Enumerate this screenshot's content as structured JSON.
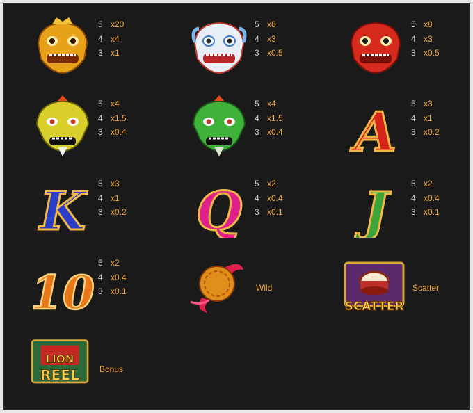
{
  "symbols": [
    {
      "name": "gold-lion",
      "pays": [
        {
          "count": "5",
          "mult": "x20"
        },
        {
          "count": "4",
          "mult": "x4"
        },
        {
          "count": "3",
          "mult": "x1"
        }
      ]
    },
    {
      "name": "white-lion",
      "pays": [
        {
          "count": "5",
          "mult": "x8"
        },
        {
          "count": "4",
          "mult": "x3"
        },
        {
          "count": "3",
          "mult": "x0.5"
        }
      ]
    },
    {
      "name": "red-lion",
      "pays": [
        {
          "count": "5",
          "mult": "x8"
        },
        {
          "count": "4",
          "mult": "x3"
        },
        {
          "count": "3",
          "mult": "x0.5"
        }
      ]
    },
    {
      "name": "yellow-lion",
      "pays": [
        {
          "count": "5",
          "mult": "x4"
        },
        {
          "count": "4",
          "mult": "x1.5"
        },
        {
          "count": "3",
          "mult": "x0.4"
        }
      ]
    },
    {
      "name": "green-lion",
      "pays": [
        {
          "count": "5",
          "mult": "x4"
        },
        {
          "count": "4",
          "mult": "x1.5"
        },
        {
          "count": "3",
          "mult": "x0.4"
        }
      ]
    },
    {
      "name": "letter-a",
      "letter": "A",
      "pays": [
        {
          "count": "5",
          "mult": "x3"
        },
        {
          "count": "4",
          "mult": "x1"
        },
        {
          "count": "3",
          "mult": "x0.2"
        }
      ]
    },
    {
      "name": "letter-k",
      "letter": "K",
      "pays": [
        {
          "count": "5",
          "mult": "x3"
        },
        {
          "count": "4",
          "mult": "x1"
        },
        {
          "count": "3",
          "mult": "x0.2"
        }
      ]
    },
    {
      "name": "letter-q",
      "letter": "Q",
      "pays": [
        {
          "count": "5",
          "mult": "x2"
        },
        {
          "count": "4",
          "mult": "x0.4"
        },
        {
          "count": "3",
          "mult": "x0.1"
        }
      ]
    },
    {
      "name": "letter-j",
      "letter": "J",
      "pays": [
        {
          "count": "5",
          "mult": "x2"
        },
        {
          "count": "4",
          "mult": "x0.4"
        },
        {
          "count": "3",
          "mult": "x0.1"
        }
      ]
    },
    {
      "name": "number-10",
      "letter": "10",
      "pays": [
        {
          "count": "5",
          "mult": "x2"
        },
        {
          "count": "4",
          "mult": "x0.4"
        },
        {
          "count": "3",
          "mult": "x0.1"
        }
      ]
    }
  ],
  "specials": {
    "wild": {
      "label": "Wild"
    },
    "scatter": {
      "label": "Scatter",
      "badge": "SCATTER"
    },
    "bonus": {
      "label": "Bonus",
      "badge_top": "LION",
      "badge_bottom": "REEL"
    }
  },
  "colors": {
    "panel_bg": "#1a1a1a",
    "count_text": "#cfcfcf",
    "multiplier_text": "#f1a73a"
  }
}
